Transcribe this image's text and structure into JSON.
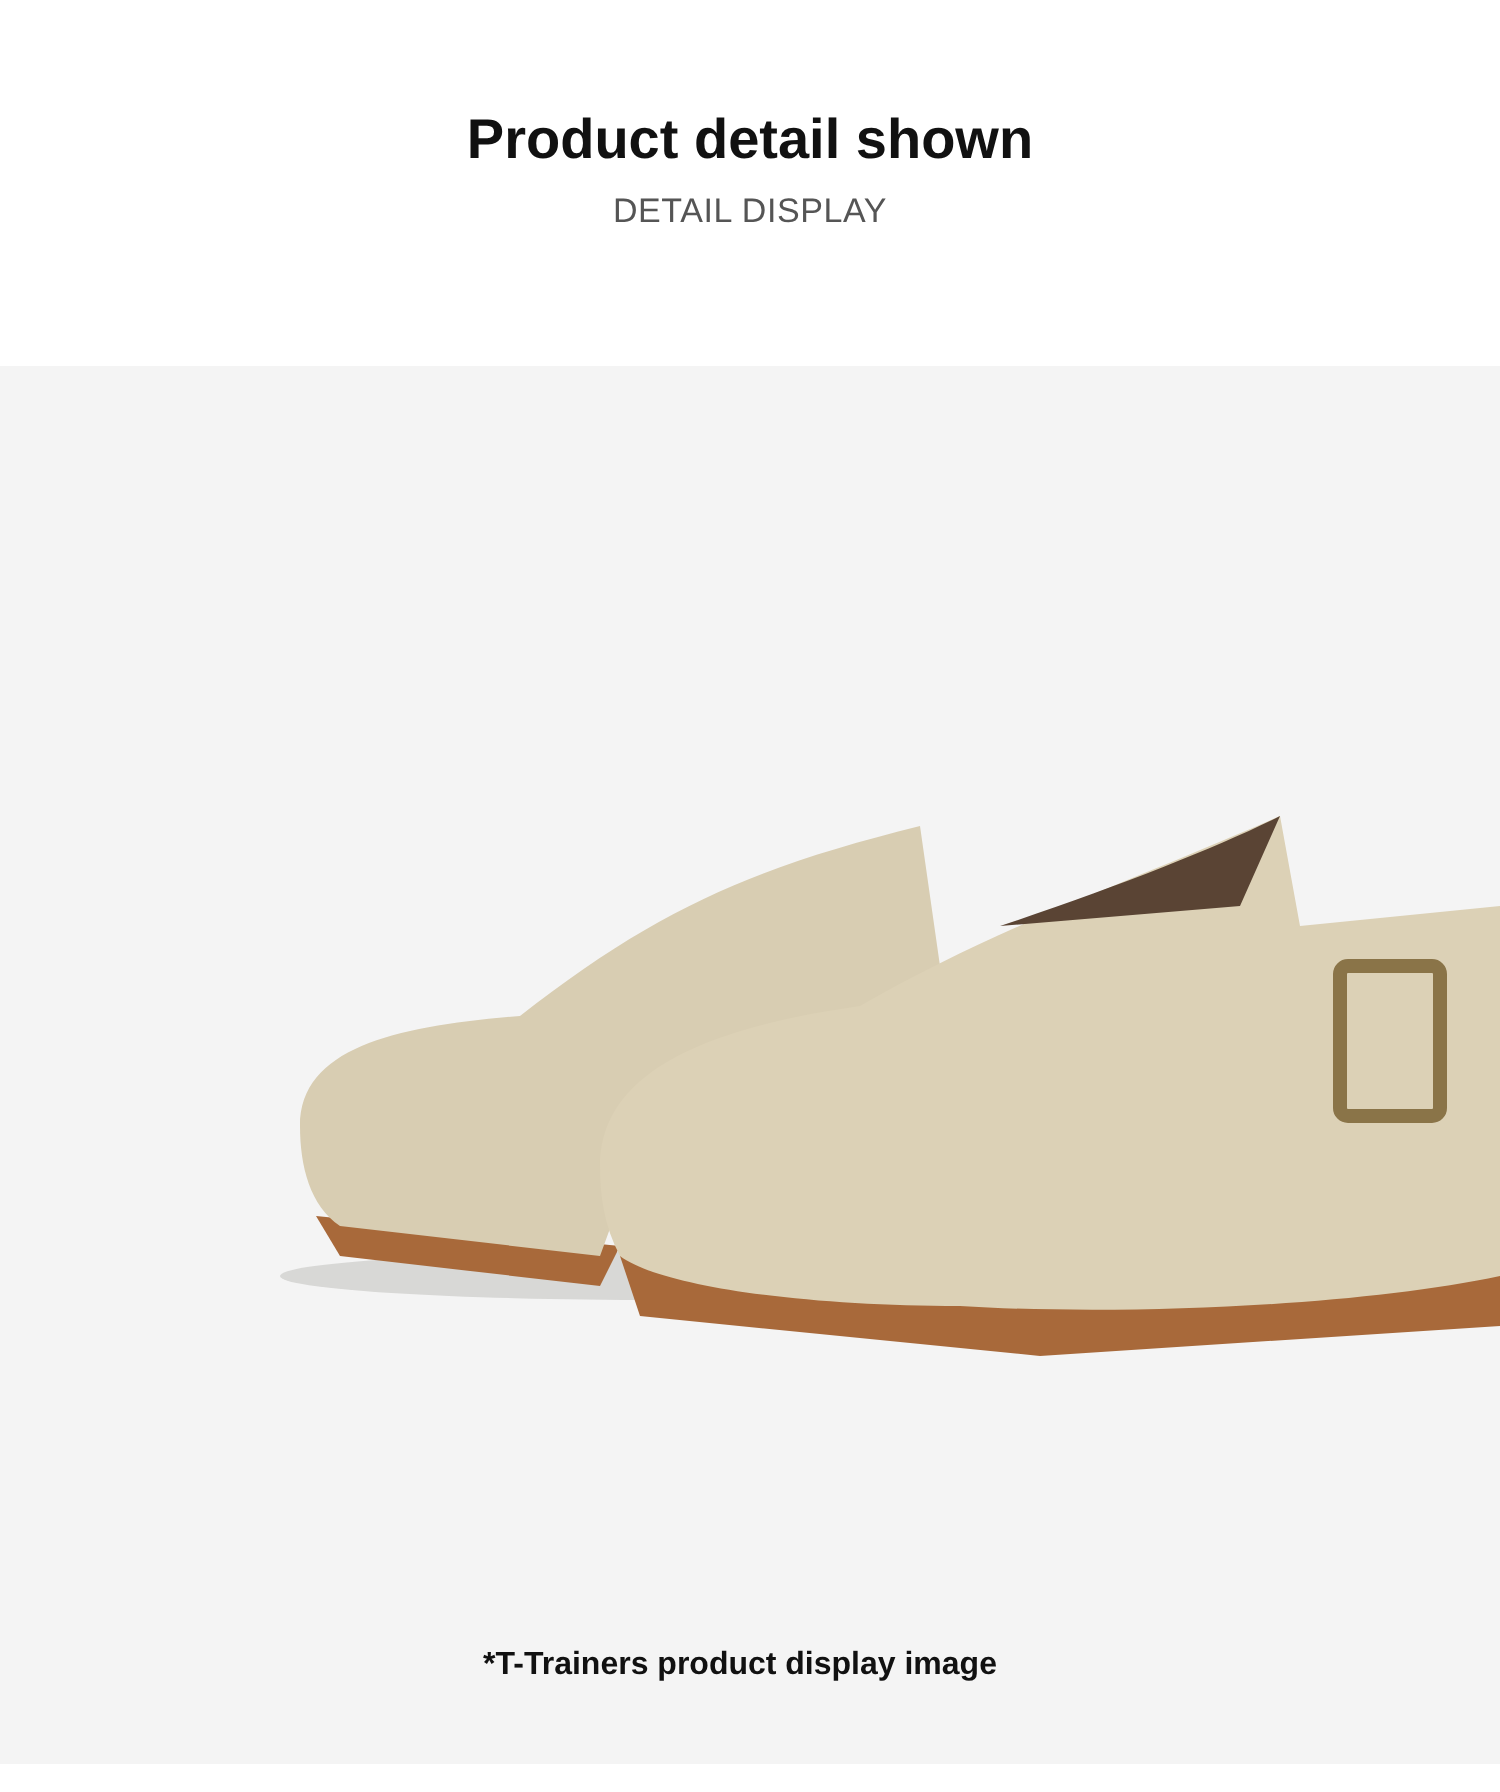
{
  "header": {
    "title": "Product detail shown",
    "subtitle": "DETAIL DISPLAY"
  },
  "photo": {
    "caption": "*T-Trainers product display image"
  }
}
